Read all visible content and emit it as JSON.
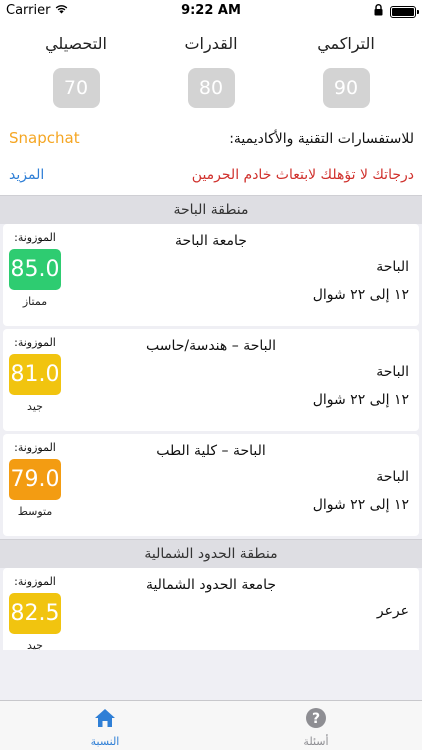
{
  "status_bar": {
    "carrier": "Carrier",
    "time": "9:22 AM"
  },
  "scores": [
    {
      "label": "التحصيلي",
      "value": "70"
    },
    {
      "label": "القدرات",
      "value": "80"
    },
    {
      "label": "التراكمي",
      "value": "90"
    }
  ],
  "contact": {
    "snapchat_label": "Snapchat",
    "text": "للاستفسارات التقنية والأكاديمية:"
  },
  "ranking": {
    "more_label": "المزيد",
    "message": "درجاتك لا تؤهلك لابتعاث خادم الحرمين"
  },
  "sections": [
    {
      "title": "منطقة الباحة",
      "items": [
        {
          "weight_label": "الموزونة:",
          "score": "85.0",
          "grade": "ممتاز",
          "color": "#2ecc71",
          "name": "جامعة الباحة",
          "city": "الباحة",
          "dates": "١٢ إلى ٢٢ شوال"
        },
        {
          "weight_label": "الموزونة:",
          "score": "81.0",
          "grade": "جيد",
          "color": "#f1c40f",
          "name": "الباحة – هندسة/حاسب",
          "city": "الباحة",
          "dates": "١٢ إلى ٢٢ شوال"
        },
        {
          "weight_label": "الموزونة:",
          "score": "79.0",
          "grade": "متوسط",
          "color": "#f39c12",
          "name": "الباحة – كلية الطب",
          "city": "الباحة",
          "dates": "١٢ إلى ٢٢ شوال"
        }
      ]
    },
    {
      "title": "منطقة الحدود الشمالية",
      "items": [
        {
          "weight_label": "الموزونة:",
          "score": "82.5",
          "grade": "جيد",
          "color": "#f1c40f",
          "name": "جامعة الحدود الشمالية",
          "city": "عرعر",
          "dates": ""
        }
      ]
    }
  ],
  "tabs": [
    {
      "label": "النسبة",
      "icon": "home-icon",
      "active": true,
      "color": "#2f7fd6"
    },
    {
      "label": "أسئلة",
      "icon": "question-icon",
      "active": false,
      "color": "#8e8e93"
    }
  ]
}
